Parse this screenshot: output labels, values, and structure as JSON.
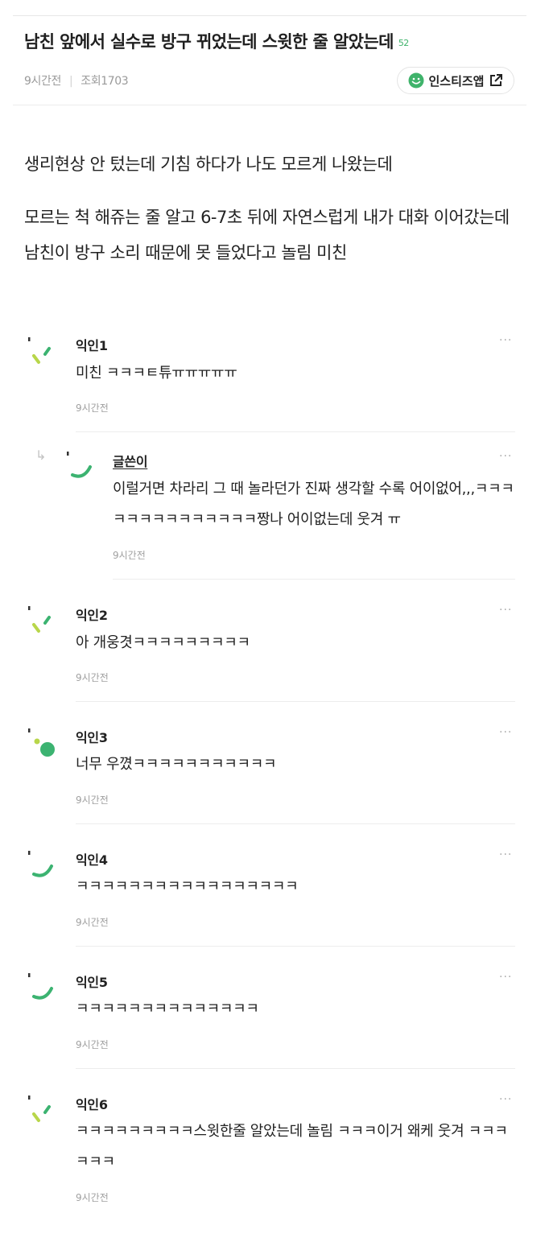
{
  "post": {
    "title": "남친 앞에서 실수로 방구 뀌었는데 스윗한 줄 알았는데",
    "comment_count": "52",
    "time": "9시간전",
    "views": "조회1703",
    "app_button": "인스티즈앱",
    "paragraphs": [
      "생리현상 안 텄는데 기침 하다가 나도 모르게 나왔는데",
      "모르는 척 해쥬는 줄 알고 6-7초 뒤에 자연스럽게 내가 대화 이어갔는데 남친이 방구 소리 때문에 못 들었다고 놀림 미친"
    ]
  },
  "comments": [
    {
      "name": "익인1",
      "text": "미친 ㅋㅋㅋㅌ튜ㅠㅠㅠㅠㅠ",
      "time": "9시간전",
      "more": "···"
    },
    {
      "name": "글쓴이",
      "text": "이럴거면 차라리 그 때 놀라던가 진짜 생각할 수록 어이없어,,,ㅋㅋㅋㅋㅋㅋㅋㅋㅋㅋㅋㅋㅋㅋ짱나 어이없는데 웃겨 ㅠ",
      "time": "9시간전",
      "more": "···"
    },
    {
      "name": "익인2",
      "text": "아 개웅겻ㅋㅋㅋㅋㅋㅋㅋㅋㅋ",
      "time": "9시간전",
      "more": "···"
    },
    {
      "name": "익인3",
      "text": "너무 우꼈ㅋㅋㅋㅋㅋㅋㅋㅋㅋㅋㅋ",
      "time": "9시간전",
      "more": "···"
    },
    {
      "name": "익인4",
      "text": "ㅋㅋㅋㅋㅋㅋㅋㅋㅋㅋㅋㅋㅋㅋㅋㅋㅋ",
      "time": "9시간전",
      "more": "···"
    },
    {
      "name": "익인5",
      "text": "ㅋㅋㅋㅋㅋㅋㅋㅋㅋㅋㅋㅋㅋㅋ",
      "time": "9시간전",
      "more": "···"
    },
    {
      "name": "익인6",
      "text": "ㅋㅋㅋㅋㅋㅋㅋㅋㅋ스윗한줄 알았는데 놀림 ㅋㅋㅋ이거 왜케 웃겨 ㅋㅋㅋㅋㅋㅋ",
      "time": "9시간전",
      "more": "···"
    }
  ],
  "colors": {
    "accent": "#3fb36b",
    "lime": "#b8d64a",
    "green": "#3cb371"
  },
  "icons": {
    "app": "smile-icon",
    "external": "external-link-icon",
    "reply": "reply-arrow-icon",
    "more": "more-dots-icon"
  }
}
